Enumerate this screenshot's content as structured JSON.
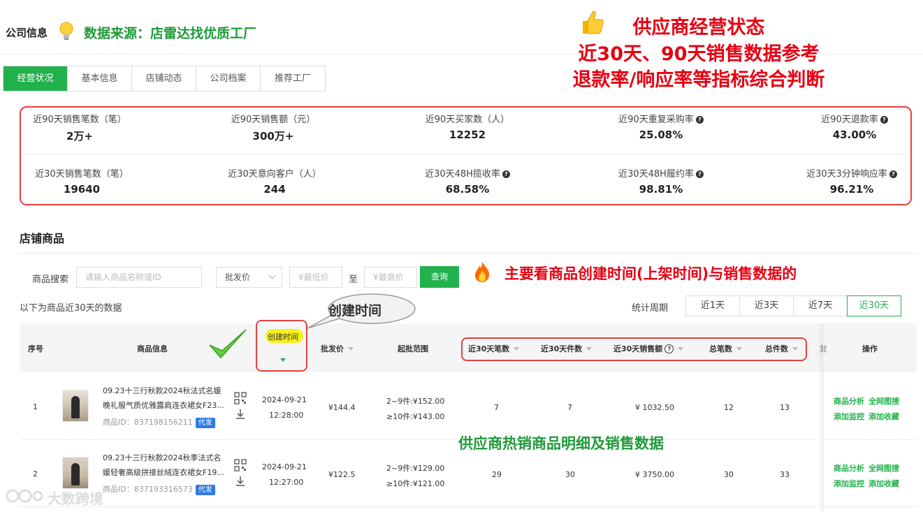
{
  "header": {
    "company_title": "公司信息",
    "source_annotation": "数据来源：店雷达找优质工厂"
  },
  "status_annotation": {
    "line1": "供应商经营状态",
    "line2": "近30天、90天销售数据参考",
    "line3": "退款率/响应率等指标综合判断"
  },
  "tabs": [
    {
      "label": "经营状况",
      "active": true
    },
    {
      "label": "基本信息"
    },
    {
      "label": "店铺动态"
    },
    {
      "label": "公司档案"
    },
    {
      "label": "推荐工厂"
    }
  ],
  "stats": {
    "row1": [
      {
        "label": "近90天销售笔数（笔）",
        "value": "2万+",
        "help": false
      },
      {
        "label": "近90天销售额（元）",
        "value": "300万+",
        "help": false
      },
      {
        "label": "近90天买家数（人）",
        "value": "12252",
        "help": false
      },
      {
        "label": "近90天重复采购率",
        "value": "25.08%",
        "help": true
      },
      {
        "label": "近90天退款率",
        "value": "43.00%",
        "help": true
      }
    ],
    "row2": [
      {
        "label": "近30天销售笔数（笔）",
        "value": "19640",
        "help": false
      },
      {
        "label": "近30天意向客户（人）",
        "value": "244",
        "help": false
      },
      {
        "label": "近30天48H揽收率",
        "value": "68.58%",
        "help": true
      },
      {
        "label": "近30天48H履约率",
        "value": "98.81%",
        "help": true
      },
      {
        "label": "近30天3分钟响应率",
        "value": "96.21%",
        "help": true
      }
    ]
  },
  "store": {
    "section_title": "店铺商品",
    "search_label": "商品搜索",
    "search_placeholder": "请输入商品名称或ID",
    "price_type": "批发价",
    "min_price_placeholder": "¥最低价",
    "to_label": "至",
    "max_price_placeholder": "¥最高价",
    "query_label": "查询",
    "note": "以下为商品近30天的数据",
    "period_label": "统计周期",
    "periods": [
      {
        "label": "近1天"
      },
      {
        "label": "近3天"
      },
      {
        "label": "近7天"
      },
      {
        "label": "近30天",
        "active": true
      }
    ]
  },
  "main_annotation": "主要看商品创建时间(上架时间)与销售数据的",
  "created_bubble": "创建时间",
  "detail_annotation": "供应商热销商品明细及销售数据",
  "table": {
    "headers": {
      "index": "序号",
      "info": "商品信息",
      "created": "创建时间",
      "price": "批发价",
      "range": "起批范围",
      "orders30": "近30天笔数",
      "pieces30": "近30天件数",
      "sales30": "近30天销售额",
      "total_orders": "总笔数",
      "total_pieces": "总件数",
      "cut": "复",
      "ops": "操作"
    },
    "rows": [
      {
        "index": "1",
        "title_line1": "09.23十三行秋款2024秋法式名媛",
        "title_line2": "晚礼服气质优雅露肩连衣裙女F23...",
        "id_label": "商品ID：",
        "id": "837198156211",
        "tag": "代发",
        "date": "2024-09-21",
        "time": "12:28:00",
        "price": "¥144.4",
        "range1": "2~9件:¥152.00",
        "range2": "≥10件:¥143.00",
        "orders30": "7",
        "pieces30": "7",
        "sales30": "¥ 1032.50",
        "total_orders": "12",
        "total_pieces": "13",
        "op1": "商品分析",
        "op2": "全网图搜",
        "op3": "添加监控",
        "op4": "添加收藏"
      },
      {
        "index": "2",
        "title_line1": "09.23十三行秋款2024秋季法式名",
        "title_line2": "媛轻奢高级拼接丝绒连衣裙女F19...",
        "id_label": "商品ID：",
        "id": "837193316573",
        "tag": "代发",
        "date": "2024-09-21",
        "time": "12:27:00",
        "price": "¥122.5",
        "range1": "2~9件:¥129.00",
        "range2": "≥10件:¥121.00",
        "orders30": "29",
        "pieces30": "30",
        "sales30": "¥ 3750.00",
        "total_orders": "30",
        "total_pieces": "33",
        "op1": "商品分析",
        "op2": "全网图搜",
        "op3": "添加监控",
        "op4": "添加收藏"
      }
    ]
  },
  "watermark": "大数跨境"
}
